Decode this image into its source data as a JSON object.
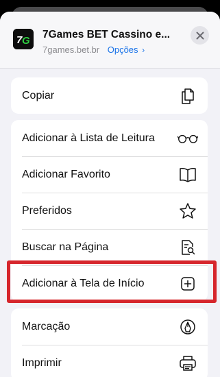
{
  "header": {
    "title": "7Games BET Cassino e...",
    "url": "7games.bet.br",
    "options_label": "Opções",
    "options_chevron": "›",
    "app_icon_text": "7G",
    "close_icon": "close-x-icon"
  },
  "groups": [
    {
      "items": [
        {
          "label": "Copiar",
          "icon": "copy-icon"
        }
      ]
    },
    {
      "items": [
        {
          "label": "Adicionar à Lista de Leitura",
          "icon": "glasses-icon"
        },
        {
          "label": "Adicionar Favorito",
          "icon": "book-icon"
        },
        {
          "label": "Preferidos",
          "icon": "star-icon"
        },
        {
          "label": "Buscar na Página",
          "icon": "find-in-page-icon"
        },
        {
          "label": "Adicionar à Tela de Início",
          "icon": "add-square-icon"
        }
      ]
    },
    {
      "items": [
        {
          "label": "Marcação",
          "icon": "markup-pen-icon"
        },
        {
          "label": "Imprimir",
          "icon": "printer-icon"
        }
      ]
    }
  ],
  "colors": {
    "highlight": "#d6262c",
    "link": "#1a73e8",
    "sheet": "#f2f2f7",
    "logo_green": "#2ecc40"
  }
}
